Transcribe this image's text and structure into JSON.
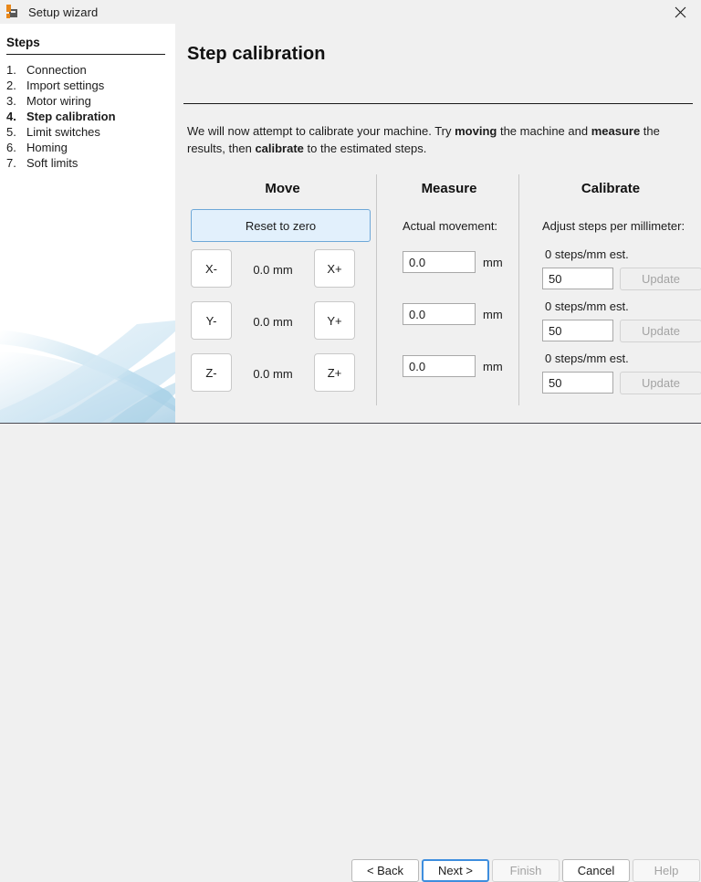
{
  "window": {
    "title": "Setup wizard",
    "app_icon": "machine-icon",
    "close_icon": "close-icon"
  },
  "sidebar": {
    "heading": "Steps",
    "items": [
      {
        "num": "1.",
        "label": "Connection",
        "active": false
      },
      {
        "num": "2.",
        "label": "Import settings",
        "active": false
      },
      {
        "num": "3.",
        "label": "Motor wiring",
        "active": false
      },
      {
        "num": "4.",
        "label": "Step calibration",
        "active": true
      },
      {
        "num": "5.",
        "label": "Limit switches",
        "active": false
      },
      {
        "num": "6.",
        "label": "Homing",
        "active": false
      },
      {
        "num": "7.",
        "label": "Soft limits",
        "active": false
      }
    ],
    "decoration": "swoosh-graphic"
  },
  "main": {
    "title": "Step calibration",
    "intro": {
      "part1": "We will now attempt to calibrate your machine. Try ",
      "bold1": "moving",
      "part2": " the machine and ",
      "bold2": "measure",
      "part3": " the results, then ",
      "bold3": "calibrate",
      "part4": " to the estimated steps."
    },
    "columns": {
      "move": {
        "heading": "Move",
        "reset_label": "Reset to zero",
        "axes": [
          {
            "minus": "X-",
            "value": "0.0 mm",
            "plus": "X+"
          },
          {
            "minus": "Y-",
            "value": "0.0 mm",
            "plus": "Y+"
          },
          {
            "minus": "Z-",
            "value": "0.0 mm",
            "plus": "Z+"
          }
        ]
      },
      "measure": {
        "heading": "Measure",
        "label": "Actual movement:",
        "unit": "mm",
        "inputs": [
          {
            "value": "0.0"
          },
          {
            "value": "0.0"
          },
          {
            "value": "0.0"
          }
        ]
      },
      "calibrate": {
        "heading": "Calibrate",
        "label": "Adjust steps per millimeter:",
        "rows": [
          {
            "estimate": "0 steps/mm est.",
            "value": "50",
            "update_label": "Update"
          },
          {
            "estimate": "0 steps/mm est.",
            "value": "50",
            "update_label": "Update"
          },
          {
            "estimate": "0 steps/mm est.",
            "value": "50",
            "update_label": "Update"
          }
        ]
      }
    }
  },
  "footer": {
    "back": "< Back",
    "next": "Next >",
    "finish": "Finish",
    "cancel": "Cancel",
    "help": "Help"
  },
  "colors": {
    "accent": "#3e8ede",
    "focus_fill": "#e2f0fc",
    "window_bg": "#f0f0f0",
    "sidebar_bg": "#ffffff",
    "disabled_text": "#a3a3a3"
  }
}
